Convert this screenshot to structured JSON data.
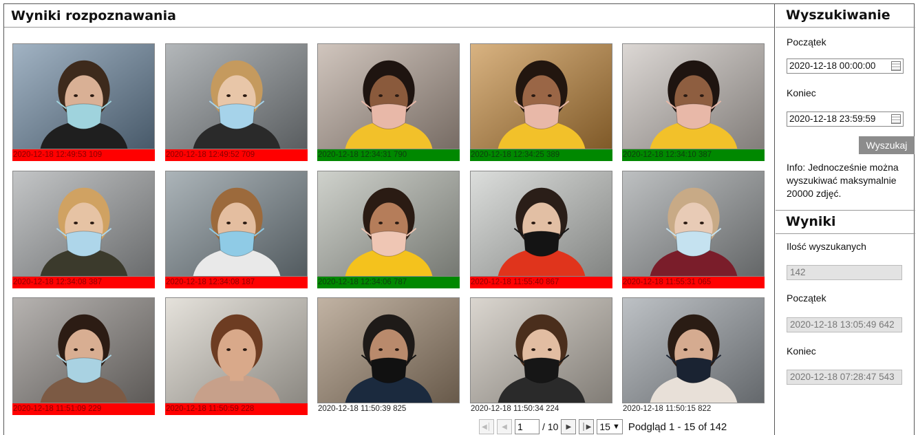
{
  "results": {
    "title": "Wyniki rozpoznawania",
    "tiles": [
      {
        "time": "2020-12-18 12:49:53 109",
        "status": "red",
        "bg": "#6f8aa3",
        "skin": "#d9b095",
        "hair": "#3d2a1c",
        "mask": "#9fd3dd",
        "cloth": "#1f1f1f"
      },
      {
        "time": "2020-12-18 12:49:52 709",
        "status": "red",
        "bg": "#8a9094",
        "skin": "#e8c6a8",
        "hair": "#c59a5e",
        "mask": "#a6d3ea",
        "cloth": "#2a2a2a"
      },
      {
        "time": "2020-12-18 12:34:31 790",
        "status": "green",
        "bg": "#b7a69a",
        "skin": "#8a5a3c",
        "hair": "#1e1410",
        "mask": "#e8b8a8",
        "cloth": "#f2c12a"
      },
      {
        "time": "2020-12-18 12:34:25 389",
        "status": "green",
        "bg": "#c48a3e",
        "skin": "#9a6646",
        "hair": "#22160f",
        "mask": "#e8b8a8",
        "cloth": "#f2c12a"
      },
      {
        "time": "2020-12-18 12:34:10 387",
        "status": "green",
        "bg": "#c9c2bd",
        "skin": "#8e5e40",
        "hair": "#1e1410",
        "mask": "#e8b8a8",
        "cloth": "#f2c12a"
      },
      {
        "time": "2020-12-18 12:34:08 387",
        "status": "red",
        "bg": "#a3a6a8",
        "skin": "#e6c3a4",
        "hair": "#d0a262",
        "mask": "#aed6ea",
        "cloth": "#3b3a2c"
      },
      {
        "time": "2020-12-18 12:34:08 187",
        "status": "red",
        "bg": "#7f8c93",
        "skin": "#e4bea0",
        "hair": "#9c6a3c",
        "mask": "#8fcbe6",
        "cloth": "#e9e9e9"
      },
      {
        "time": "2020-12-18 12:34:06 787",
        "status": "green",
        "bg": "#b5b9b0",
        "skin": "#b57d5a",
        "hair": "#2a1b13",
        "mask": "#efc6b4",
        "cloth": "#f4c21d"
      },
      {
        "time": "2020-12-18 11:55:40 867",
        "status": "red",
        "bg": "#c9ccc9",
        "skin": "#e2bfa4",
        "hair": "#2a1e18",
        "mask": "#141414",
        "cloth": "#e0341c"
      },
      {
        "time": "2020-12-18 11:55:31 065",
        "status": "red",
        "bg": "#9a9ea0",
        "skin": "#e8cbb6",
        "hair": "#c8aa86",
        "mask": "#c5e2f0",
        "cloth": "#7a1d2a"
      },
      {
        "time": "2020-12-18 11:51:09 229",
        "status": "red",
        "bg": "#8f8a86",
        "skin": "#d8ae92",
        "hair": "#2c1c14",
        "mask": "#a9d2e2",
        "cloth": "#7c5a44"
      },
      {
        "time": "2020-12-18 11:50:59 228",
        "status": "red",
        "bg": "#d7d2c8",
        "skin": "#d9a98a",
        "hair": "#6d3c22",
        "mask": "none",
        "cloth": "#c7a08a"
      },
      {
        "time": "2020-12-18 11:50:39 825",
        "status": "none",
        "bg": "#a08a72",
        "skin": "#b98a6c",
        "hair": "#1e1a18",
        "mask": "#111111",
        "cloth": "#1b2a3e"
      },
      {
        "time": "2020-12-18 11:50:34 224",
        "status": "none",
        "bg": "#c7c0b6",
        "skin": "#e2bda2",
        "hair": "#4a2e1c",
        "mask": "#161616",
        "cloth": "#2a2a2a"
      },
      {
        "time": "2020-12-18 11:50:15 822",
        "status": "none",
        "bg": "#9aa0a6",
        "skin": "#d5ab90",
        "hair": "#2a1c14",
        "mask": "#1a2332",
        "cloth": "#e8e0d8"
      }
    ]
  },
  "pager": {
    "page": "1",
    "total_pages": "/ 10",
    "per_page": "15",
    "summary": "Podgląd 1 - 15 of 142"
  },
  "search": {
    "title": "Wyszukiwanie",
    "start_label": "Początek",
    "start_value": "2020-12-18 00:00:00",
    "end_label": "Koniec",
    "end_value": "2020-12-18 23:59:59",
    "button": "Wyszukaj",
    "info": "Info: Jednocześnie można wyszukiwać maksymalnie 20000 zdjęć."
  },
  "summary": {
    "title": "Wyniki",
    "count_label": "Ilość wyszukanych",
    "count_value": "142",
    "start_label": "Początek",
    "start_value": "2020-12-18 13:05:49 642",
    "end_label": "Koniec",
    "end_value": "2020-12-18 07:28:47 543"
  }
}
